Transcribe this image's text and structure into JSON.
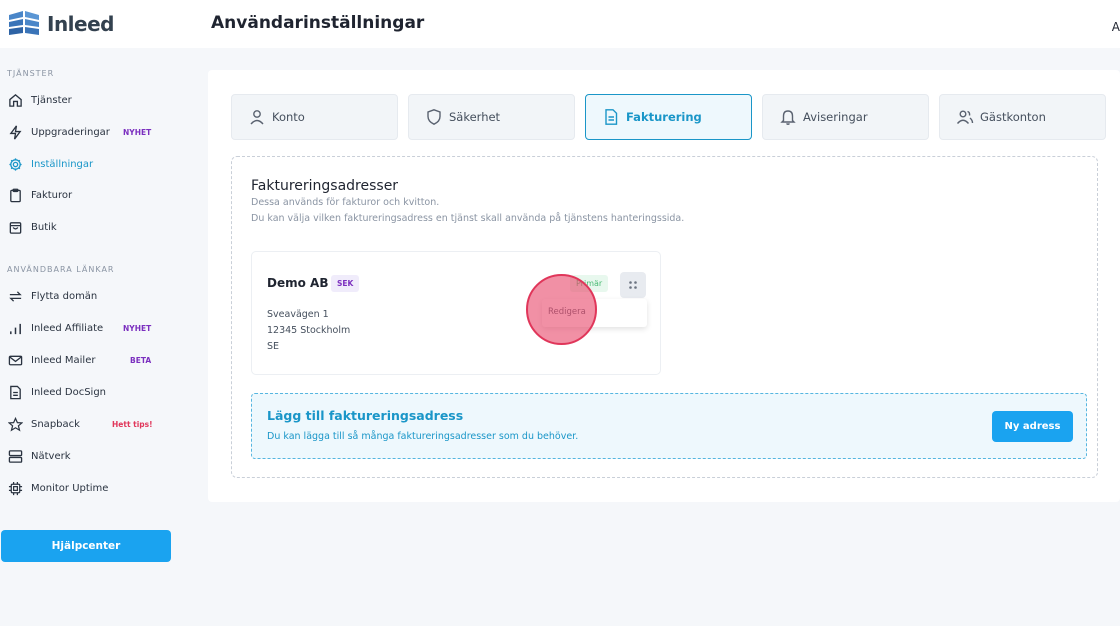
{
  "app": {
    "brand_name": "Inleed",
    "page_title": "Användarinställningar",
    "header_edge_text": "A"
  },
  "sidebar": {
    "section_services": "TJÄNSTER",
    "section_links": "ANVÄNDBARA LÄNKAR",
    "items": [
      {
        "label": "Tjänster",
        "icon": "home-icon"
      },
      {
        "label": "Uppgraderingar",
        "icon": "lightning-icon",
        "badge": "NYHET",
        "badge_color": "#7b2fbf"
      },
      {
        "label": "Inställningar",
        "icon": "gear-icon",
        "active": true
      },
      {
        "label": "Fakturor",
        "icon": "clipboard-icon"
      },
      {
        "label": "Butik",
        "icon": "bag-icon"
      },
      {
        "label": "Flytta domän",
        "icon": "transfer-icon"
      },
      {
        "label": "Inleed Affiliate",
        "icon": "bar-chart-icon",
        "badge": "NYHET",
        "badge_color": "#7b2fbf"
      },
      {
        "label": "Inleed Mailer",
        "icon": "mail-icon",
        "badge": "BETA",
        "badge_color": "#7b2fbf"
      },
      {
        "label": "Inleed DocSign",
        "icon": "document-icon"
      },
      {
        "label": "Snapback",
        "icon": "star-icon",
        "badge": "Hett tips!",
        "badge_color": "#e0365a"
      },
      {
        "label": "Nätverk",
        "icon": "server-icon"
      },
      {
        "label": "Monitor Uptime",
        "icon": "chip-icon"
      }
    ],
    "help_button": "Hjälpcenter"
  },
  "tabs": [
    {
      "label": "Konto",
      "icon": "user-icon"
    },
    {
      "label": "Säkerhet",
      "icon": "shield-icon"
    },
    {
      "label": "Fakturering",
      "icon": "invoice-icon",
      "active": true
    },
    {
      "label": "Aviseringar",
      "icon": "bell-icon"
    },
    {
      "label": "Gästkonton",
      "icon": "users-icon"
    }
  ],
  "billing": {
    "title": "Faktureringsadresser",
    "desc_line1": "Dessa används för fakturor och kvitton.",
    "desc_line2": "Du kan välja vilken faktureringsadress en tjänst skall använda på tjänstens hanteringssida.",
    "address": {
      "name": "Demo AB",
      "currency": "SEK",
      "primary_badge": "Primär",
      "street": "Sveavägen 1",
      "city": "12345 Stockholm",
      "country": "SE",
      "menu_item_edit": "Redigera"
    },
    "add": {
      "title": "Lägg till faktureringsadress",
      "desc": "Du kan lägga till så många faktureringsadresser som du behöver.",
      "button": "Ny adress"
    }
  },
  "colors": {
    "accent": "#1a96c8",
    "button": "#1aa3f0",
    "badge_purple": "#7b2fbf",
    "badge_red": "#e0365a",
    "click_marker": "#e0365a"
  }
}
